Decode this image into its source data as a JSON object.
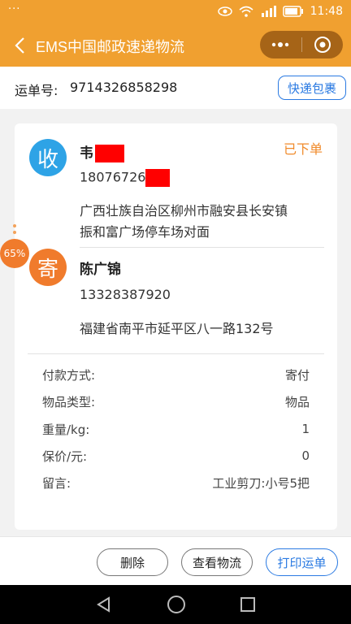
{
  "status_bar": {
    "menu_dots": "···",
    "time": "11:48",
    "battery_icon": "battery-icon",
    "wifi_icon": "wifi-icon",
    "signal_icon": "signal-icon",
    "eye_icon": "eye-icon"
  },
  "app_bar": {
    "title": "EMS中国邮政速递物流",
    "back_icon": "chevron-left-icon",
    "more_icon": "more-dots-icon",
    "close_icon": "target-close-icon",
    "color": "#f0a030"
  },
  "header": {
    "label": "运单号:",
    "tracking_number": "9714326858298",
    "tag_button": "快递包裹"
  },
  "receiver": {
    "badge": "收",
    "name": "韦",
    "phone": "18076726",
    "address_line1": "广西壮族自治区柳州市融安县长安镇",
    "address_line2": "振和富广场停车场对面",
    "status": "已下单"
  },
  "sender": {
    "badge": "寄",
    "name": "陈广锦",
    "phone": "13328387920",
    "address": "福建省南平市延平区八一路132号"
  },
  "details": [
    {
      "label": "付款方式:",
      "value": "寄付"
    },
    {
      "label": "物品类型:",
      "value": "物品"
    },
    {
      "label": "重量/kg:",
      "value": "1"
    },
    {
      "label": "保价/元:",
      "value": "0"
    },
    {
      "label": "留言:",
      "value": "工业剪刀:小号5把"
    }
  ],
  "floating_bubble": {
    "text": "65%"
  },
  "actions": {
    "delete": "删除",
    "view_logistics": "查看物流",
    "print": "打印运单"
  },
  "nav": {
    "back_icon": "triangle-back-icon",
    "home_icon": "circle-home-icon",
    "recent_icon": "square-recent-icon"
  }
}
